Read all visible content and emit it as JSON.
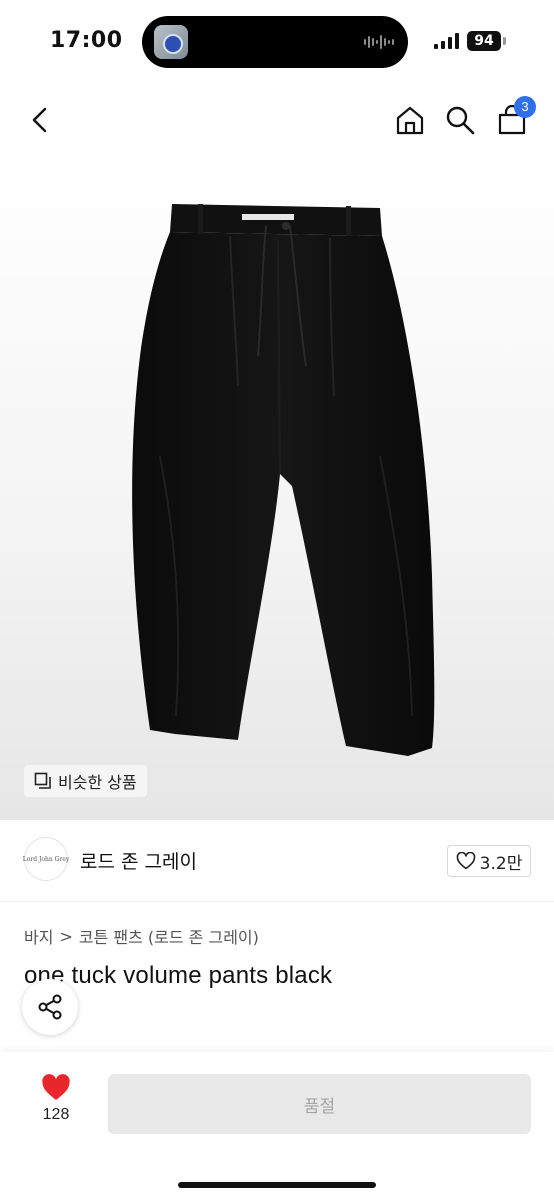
{
  "status_bar": {
    "time": "17:00",
    "battery": "94",
    "icons": [
      "island-thumbnail-icon",
      "audio-wave-icon",
      "signal-icon"
    ]
  },
  "nav": {
    "icons": [
      "back-chevron-icon",
      "home-icon",
      "search-icon",
      "cart-icon"
    ],
    "cart_count": "3",
    "accent": "#2f6fe8"
  },
  "product_image": {
    "similar_label": "비슷한 상품",
    "similar_icon": "copy-icon"
  },
  "brand": {
    "logo_text": "Lord John Grey",
    "name": "로드 존 그레이",
    "like_count": "3.2만",
    "like_icon": "heart-outline-icon"
  },
  "breadcrumb": {
    "category": "바지",
    "separator": ">",
    "subcategory": "코튼 팬츠 (로드 존 그레이)"
  },
  "product": {
    "title": "one tuck volume pants black",
    "share_icon": "share-icon"
  },
  "bottom_bar": {
    "wish_count": "128",
    "wish_icon": "heart-filled-icon",
    "wish_color": "#e8262c",
    "soldout_label": "품절"
  }
}
